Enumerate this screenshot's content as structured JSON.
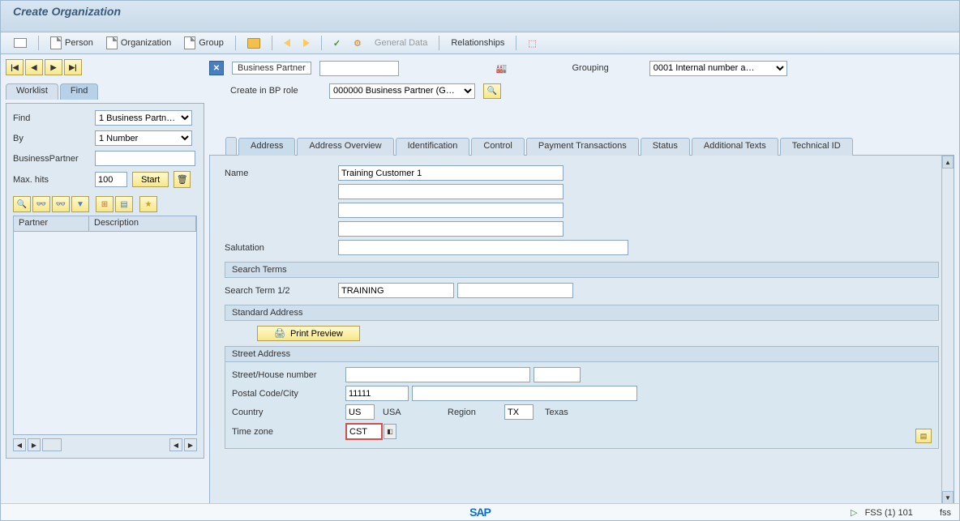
{
  "title": "Create Organization",
  "toolbar": {
    "person": "Person",
    "organization": "Organization",
    "group": "Group",
    "general_data": "General Data",
    "relationships": "Relationships"
  },
  "left": {
    "tabs": {
      "worklist": "Worklist",
      "find": "Find"
    },
    "find_label": "Find",
    "find_value": "1 Business Partn…",
    "by_label": "By",
    "by_value": "1 Number",
    "bp_label": "BusinessPartner",
    "max_hits_label": "Max. hits",
    "max_hits_value": "100",
    "start": "Start",
    "cols": {
      "partner": "Partner",
      "description": "Description"
    }
  },
  "header": {
    "bp_label": "Business Partner",
    "grouping_label": "Grouping",
    "grouping_value": "0001 Internal number a…",
    "role_label": "Create in BP role",
    "role_value": "000000 Business Partner (G…"
  },
  "tabs": {
    "address": "Address",
    "overview": "Address Overview",
    "identification": "Identification",
    "control": "Control",
    "payment": "Payment Transactions",
    "status": "Status",
    "addtexts": "Additional Texts",
    "techid": "Technical ID"
  },
  "detail": {
    "name_label": "Name",
    "name_value": "Training Customer 1",
    "salutation_label": "Salutation",
    "search_terms_hdr": "Search Terms",
    "search_term_label": "Search Term 1/2",
    "search_term_value": "TRAINING",
    "std_addr_hdr": "Standard Address",
    "print_preview": "Print Preview",
    "street_addr_hdr": "Street Address",
    "street_label": "Street/House number",
    "postal_label": "Postal Code/City",
    "postal_value": "11111",
    "country_label": "Country",
    "country_code": "US",
    "country_name": "USA",
    "region_label": "Region",
    "region_code": "TX",
    "region_name": "Texas",
    "tz_label": "Time zone",
    "tz_value": "CST"
  },
  "status": {
    "right": "FSS (1) 101",
    "far_right": "fss"
  }
}
